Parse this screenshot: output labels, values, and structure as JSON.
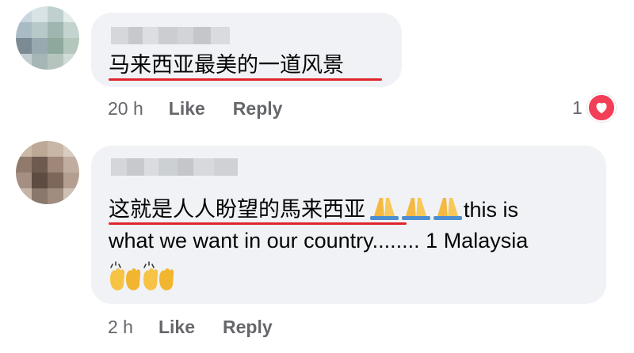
{
  "comments": [
    {
      "text": "马来西亚最美的一道风景",
      "time": "20 h",
      "like_label": "Like",
      "reply_label": "Reply",
      "reaction_count": "1",
      "reaction_icon": "heart-icon",
      "reaction_color": "#f33e58"
    },
    {
      "text_zh": "这就是人人盼望的馬来西亚",
      "text_en_1": "this is",
      "text_en_2": "what we want in our country........ 1 Malaysia",
      "emoji_inline": "folded-hands-icon",
      "emoji_trailing": "raising-hands-icon",
      "time": "2 h",
      "like_label": "Like",
      "reply_label": "Reply"
    }
  ],
  "colors": {
    "bubble": "#f0f2f5",
    "underline": "#e0242a",
    "meta_text": "#65676b"
  }
}
